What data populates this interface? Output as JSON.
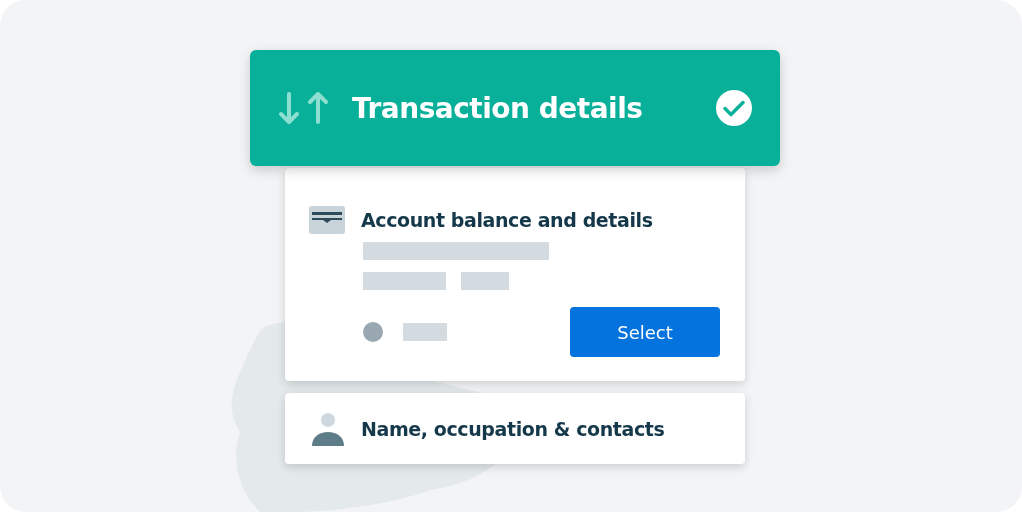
{
  "header": {
    "title": "Transaction details",
    "completed": true
  },
  "sections": [
    {
      "kind": "expanded",
      "title": "Account balance and details",
      "button": "Select"
    },
    {
      "kind": "collapsed",
      "title": "Name, occupation & contacts"
    }
  ]
}
